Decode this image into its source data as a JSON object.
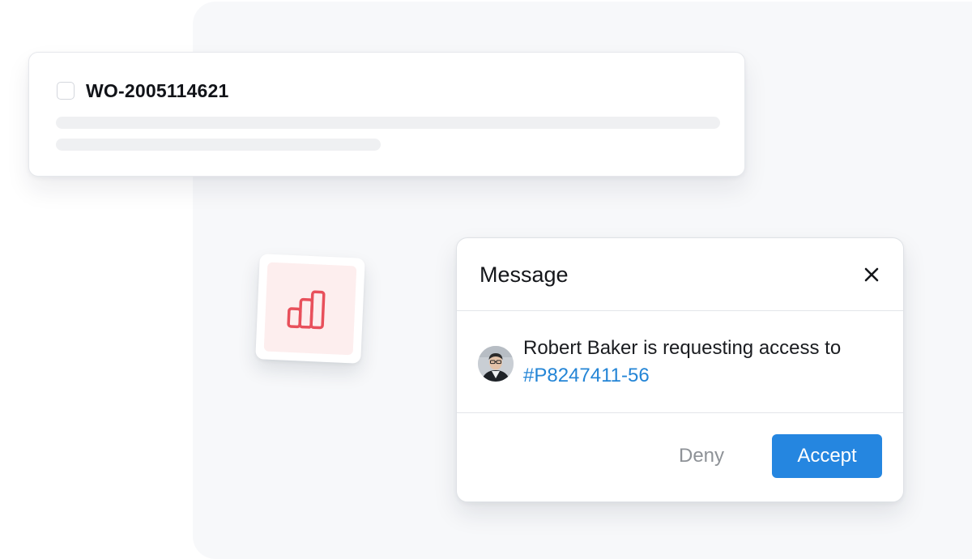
{
  "work_order": {
    "id": "WO-2005114621",
    "checked": false
  },
  "chart_tile": {
    "icon": "bar-chart-icon",
    "icon_color": "#e8505b",
    "background_color": "#fdeeee"
  },
  "dialog": {
    "title": "Message",
    "close_icon": "close-icon",
    "requester_name": "Robert Baker",
    "message_text": "Robert Baker is requesting access to",
    "project_link": "#P8247411-56",
    "deny_label": "Deny",
    "accept_label": "Accept",
    "accent_color": "#2586e0"
  }
}
